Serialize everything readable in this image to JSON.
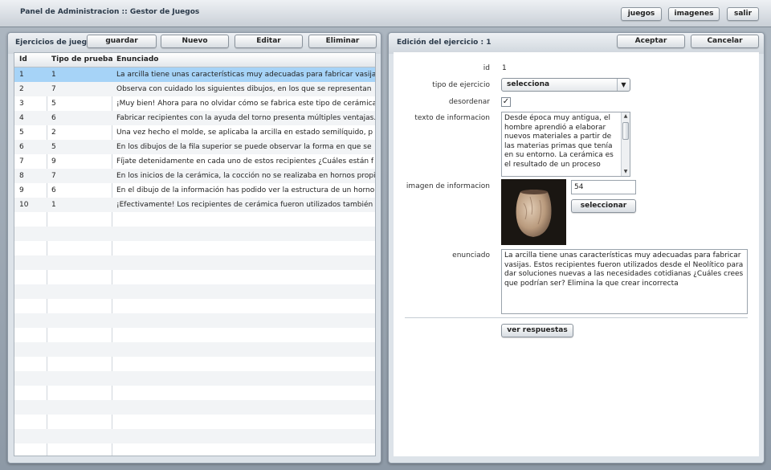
{
  "app": {
    "title": "Panel de Administracion :: Gestor de Juegos"
  },
  "topnav": {
    "juegos": "juegos",
    "imagenes": "imagenes",
    "salir": "salir"
  },
  "left_panel": {
    "title": "Ejercicios de juego d",
    "buttons": {
      "guardar": "guardar",
      "nuevo": "Nuevo",
      "editar": "Editar",
      "eliminar": "Eliminar"
    },
    "columns": [
      "Id",
      "Tipo de prueba",
      "Enunciado"
    ],
    "rows": [
      {
        "id": "1",
        "tipo": "1",
        "enunciado": "La arcilla tiene unas características muy adecuadas para fabricar vasijas"
      },
      {
        "id": "2",
        "tipo": "7",
        "enunciado": "Observa con cuidado los siguientes dibujos, en los que se representan"
      },
      {
        "id": "3",
        "tipo": "5",
        "enunciado": "¡Muy bien! Ahora para no olvidar cómo se fabrica este tipo de cerámica"
      },
      {
        "id": "4",
        "tipo": "6",
        "enunciado": "Fabricar recipientes con la ayuda del torno presenta múltiples ventajas."
      },
      {
        "id": "5",
        "tipo": "2",
        "enunciado": "Una vez hecho el molde, se aplicaba la arcilla en estado semilíquido, p"
      },
      {
        "id": "6",
        "tipo": "5",
        "enunciado": "En los dibujos de la fila superior se puede observar la forma en que se"
      },
      {
        "id": "7",
        "tipo": "9",
        "enunciado": "Fíjate detenidamente en cada uno de estos recipientes ¿Cuáles están f"
      },
      {
        "id": "8",
        "tipo": "7",
        "enunciado": "En los inicios de la cerámica, la cocción no se realizaba en hornos propi"
      },
      {
        "id": "9",
        "tipo": "6",
        "enunciado": "En el dibujo de la información has podido ver la estructura de un horno"
      },
      {
        "id": "10",
        "tipo": "1",
        "enunciado": "¡Efectivamente! Los recipientes de cerámica fueron utilizados también p"
      }
    ]
  },
  "right_panel": {
    "title": "Edición del ejercicio : 1",
    "buttons": {
      "aceptar": "Aceptar",
      "cancelar": "Cancelar"
    },
    "labels": {
      "id": "id",
      "tipo": "tipo de ejercicio",
      "desordenar": "desordenar",
      "texto": "texto de informacion",
      "imagen": "imagen de informacion",
      "enunciado": "enunciado"
    },
    "id_value": "1",
    "tipo_value": "selecciona",
    "desordenar_checked": "✓",
    "texto_value": "Desde época muy antigua, el hombre aprendió a elaborar nuevos materiales a partir de las materias primas que tenía en su entorno. La cerámica es el resultado de un proceso",
    "imagen_value": "54",
    "seleccionar": "seleccionar",
    "enunciado_value": "La arcilla tiene unas características muy adecuadas para fabricar vasijas. Estos recipientes fueron utilizados desde el Neolítico para dar soluciones nuevas a las necesidades cotidianas ¿Cuáles crees que podrían ser? Elimina la que crear incorrecta",
    "ver_respuestas": "ver respuestas"
  }
}
